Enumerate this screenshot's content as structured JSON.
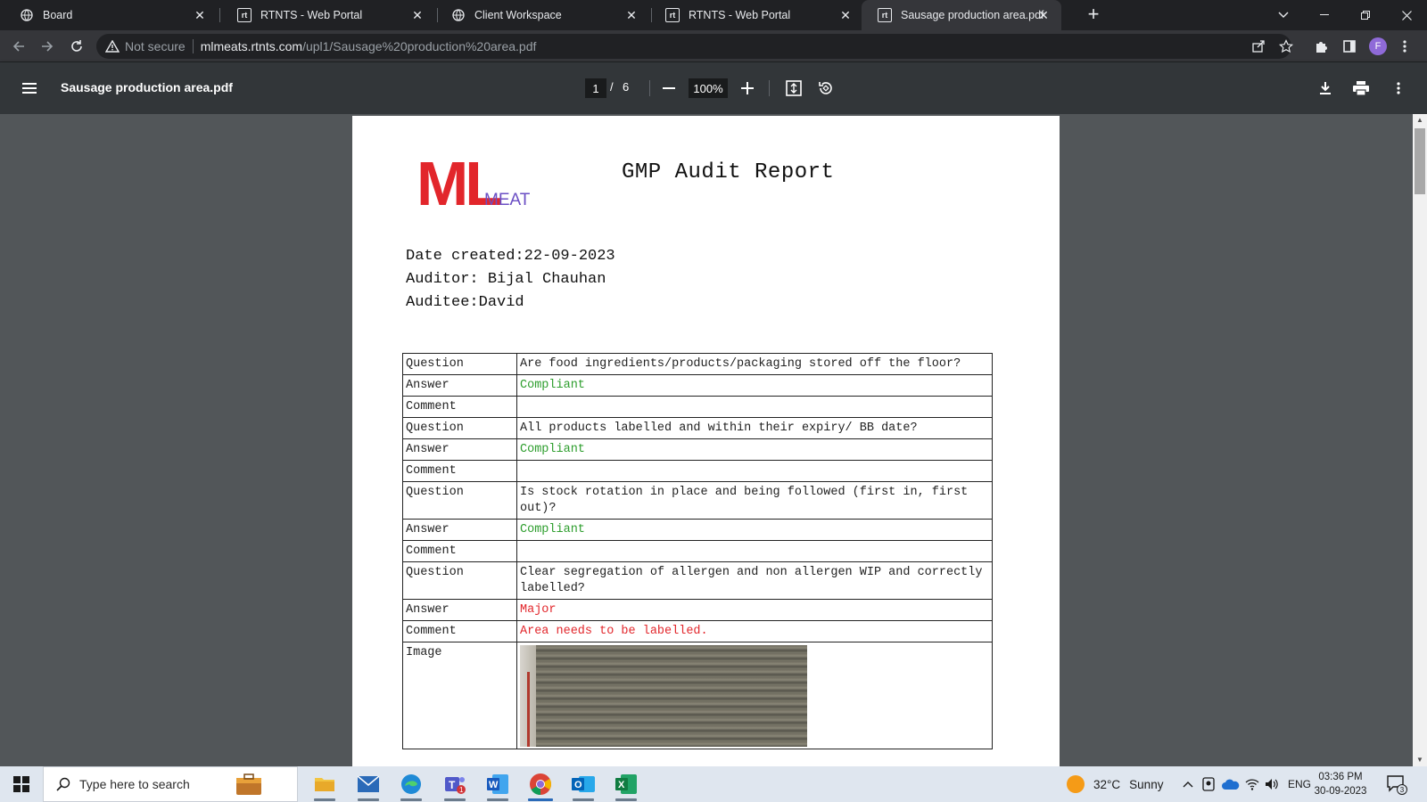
{
  "browser": {
    "tabs": [
      {
        "title": "Board",
        "icon": "globe-icon"
      },
      {
        "title": "RTNTS - Web Portal",
        "icon": "rt-logo-icon"
      },
      {
        "title": "Client Workspace",
        "icon": "globe-icon"
      },
      {
        "title": "RTNTS - Web Portal",
        "icon": "rt-logo-icon"
      },
      {
        "title": "Sausage production area.pdf",
        "icon": "rt-logo-icon",
        "active": true
      }
    ],
    "rt_fav_text": "rt",
    "security_label": "Not secure",
    "url_host": "mlmeats.rtnts.com",
    "url_path": "/upl1/Sausage%20production%20area.pdf",
    "profile_initial": "F"
  },
  "pdf": {
    "filename": "Sausage production area.pdf",
    "current_page": "1",
    "page_separator": "/",
    "total_pages": "6",
    "zoom": "100%"
  },
  "document": {
    "logo": {
      "letters": "ML",
      "word": "MEAT"
    },
    "title": "GMP Audit Report",
    "date_created": "Date created:22-09-2023",
    "auditor": "Auditor: Bijal Chauhan",
    "auditee": "Auditee:David",
    "rows": [
      {
        "label": "Question",
        "value": "Are food ingredients/products/packaging stored off the floor?",
        "tone": ""
      },
      {
        "label": "Answer",
        "value": "Compliant",
        "tone": "green"
      },
      {
        "label": "Comment",
        "value": "",
        "tone": ""
      },
      {
        "label": "Question",
        "value": "All products labelled and within their expiry/ BB date?",
        "tone": ""
      },
      {
        "label": "Answer",
        "value": "Compliant",
        "tone": "green"
      },
      {
        "label": "Comment",
        "value": "",
        "tone": ""
      },
      {
        "label": "Question",
        "value": "Is stock rotation in place and being followed (first in, first out)?",
        "tone": ""
      },
      {
        "label": "Answer",
        "value": "Compliant",
        "tone": "green"
      },
      {
        "label": "Comment",
        "value": "",
        "tone": ""
      },
      {
        "label": "Question",
        "value": "Clear segregation of allergen and non allergen WIP and correctly labelled?",
        "tone": ""
      },
      {
        "label": "Answer",
        "value": "Major",
        "tone": "red"
      },
      {
        "label": "Comment",
        "value": "Area needs to be labelled.",
        "tone": "red"
      }
    ],
    "image_label": "Image"
  },
  "taskbar": {
    "search_placeholder": "Type here to search",
    "weather_temp": "32°C",
    "weather_desc": "Sunny",
    "language": "ENG",
    "time": "03:36 PM",
    "date": "30-09-2023",
    "notification_count": "3",
    "teams_badge": "1"
  },
  "colors": {
    "compliant": "#2e9e2e",
    "major": "#e2262b",
    "logo_red": "#e2262b",
    "logo_purple": "#6b4fc4"
  }
}
